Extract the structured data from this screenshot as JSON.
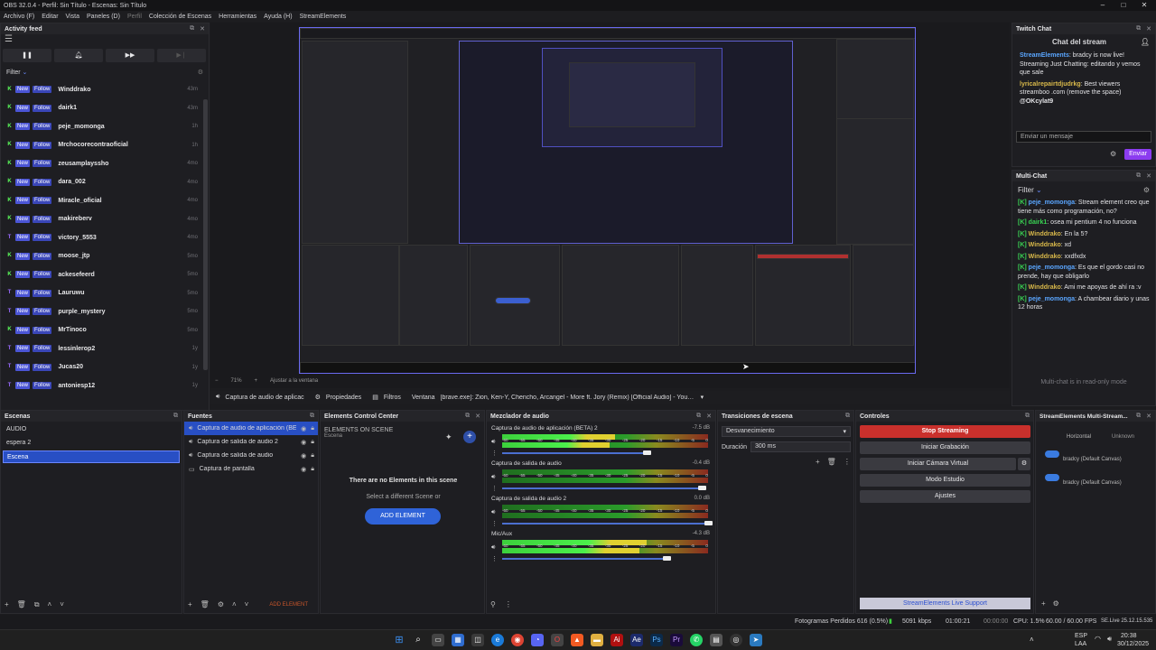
{
  "window": {
    "title": "OBS 32.0.4 - Perfil: Sin Título - Escenas: Sin Título"
  },
  "menu": [
    "Archivo (F)",
    "Editar",
    "Vista",
    "Paneles (D)",
    "Perfil",
    "Colección de Escenas",
    "Herramientas",
    "Ayuda (H)",
    "StreamElements"
  ],
  "activity_feed": {
    "title": "Activity feed",
    "filter_label": "Filter",
    "badge_new": "New",
    "badge_follow": "Follow",
    "items": [
      {
        "platform": "K",
        "name": "Winddrako",
        "time": "43m"
      },
      {
        "platform": "K",
        "name": "dairk1",
        "time": "43m"
      },
      {
        "platform": "K",
        "name": "peje_momonga",
        "time": "1h"
      },
      {
        "platform": "K",
        "name": "Mrchocorecontraoficial",
        "time": "1h"
      },
      {
        "platform": "K",
        "name": "zeusamplayssho",
        "time": "4mo"
      },
      {
        "platform": "K",
        "name": "dara_002",
        "time": "4mo"
      },
      {
        "platform": "K",
        "name": "Miracle_oficial",
        "time": "4mo"
      },
      {
        "platform": "K",
        "name": "makireberv",
        "time": "4mo"
      },
      {
        "platform": "T",
        "name": "victory_5553",
        "time": "4mo"
      },
      {
        "platform": "K",
        "name": "moose_jtp",
        "time": "5mo"
      },
      {
        "platform": "K",
        "name": "ackesefeerd",
        "time": "5mo"
      },
      {
        "platform": "T",
        "name": "Lauruwu",
        "time": "5mo"
      },
      {
        "platform": "T",
        "name": "purple_mystery",
        "time": "5mo"
      },
      {
        "platform": "K",
        "name": "MrTinoco",
        "time": "5mo"
      },
      {
        "platform": "T",
        "name": "lessinlerop2",
        "time": "1y"
      },
      {
        "platform": "T",
        "name": "Jucas20",
        "time": "1y"
      },
      {
        "platform": "T",
        "name": "antoniesp12",
        "time": "1y"
      }
    ]
  },
  "preview_bar": {
    "zoom": "71%",
    "fit": "Ajustar a la ventana"
  },
  "source_toolbar": {
    "source": "Captura de audio de aplicac",
    "properties": "Propiedades",
    "filters": "Filtros",
    "window_label": "Ventana",
    "window_value": "[brave.exe]: Zion, Ken-Y, Chencho, Arcangel - More ft. Jory (Remix) [Official Audio] - YouTube - Br"
  },
  "twitch_chat": {
    "title": "Twitch Chat",
    "header": "Chat del stream",
    "messages": [
      {
        "user": "StreamElements",
        "text": ": bradcy is now live! Streaming Just Chatting: editando y vemos que sale"
      },
      {
        "user": "lyricalrepairtdjudrkg",
        "text": ": Best viewers streamboo .com (remove the space) ",
        "mention": "@OKcylat9"
      }
    ],
    "input_placeholder": "Enviar un mensaje",
    "send": "Enviar"
  },
  "multichat": {
    "title": "Multi-Chat",
    "filter": "Filter",
    "messages": [
      {
        "user": "peje_momonga",
        "text": ": Stream element creo que tiene más como programación, no?",
        "color": "blue"
      },
      {
        "user": "dairk1",
        "text": ": osea mi pentium 4 no funciona",
        "color": "green"
      },
      {
        "user": "Winddrako",
        "text": ": En la 5?",
        "color": "gold"
      },
      {
        "user": "Winddrako",
        "text": ": xd",
        "color": "gold"
      },
      {
        "user": "Winddrako",
        "text": ": xxdfxdx",
        "color": "gold"
      },
      {
        "user": "peje_momonga",
        "text": ": Es que el gordo casi no prende, hay que obligarlo",
        "color": "blue"
      },
      {
        "user": "Winddrako",
        "text": ": Ami me apoyas de ahí ra :v",
        "color": "gold"
      },
      {
        "user": "peje_momonga",
        "text": ": A chambear diario y unas 12 horas",
        "color": "blue"
      }
    ],
    "readonly": "Multi-chat is in read-only mode"
  },
  "scenes": {
    "title": "Escenas",
    "items": [
      "AUDIO",
      "espera 2",
      "Escena"
    ],
    "selected": 2
  },
  "sources": {
    "title": "Fuentes",
    "items": [
      "Captura de audio de aplicación (BE",
      "Captura de salida de audio 2",
      "Captura de salida de audio",
      "Captura de pantalla"
    ],
    "add_element": "ADD ELEMENT"
  },
  "ecc": {
    "title": "Elements Control Center",
    "header": "ELEMENTS ON SCENE",
    "sub": "Escena",
    "empty": "There are no Elements in this scene",
    "hint": "Select a different Scene or",
    "button": "ADD ELEMENT"
  },
  "mixer": {
    "title": "Mezclador de audio",
    "ticks": [
      "-60",
      "-55",
      "-50",
      "-45",
      "-40",
      "-35",
      "-30",
      "-25",
      "-20",
      "-15",
      "-10",
      "-5",
      "0"
    ],
    "channels": [
      {
        "name": "Captura de audio de aplicación (BETA) 2",
        "db": "-7.5 dB",
        "level": 0.55,
        "volume": 0.7
      },
      {
        "name": "Captura de salida de audio",
        "db": "-0.4 dB",
        "level": 0.0,
        "volume": 0.97
      },
      {
        "name": "Captura de salida de audio 2",
        "db": "0.0 dB",
        "level": 0.0,
        "volume": 1.0
      },
      {
        "name": "Mic/Aux",
        "db": "-4.3 dB",
        "level": 0.7,
        "volume": 0.8
      }
    ]
  },
  "transitions": {
    "title": "Transiciones de escena",
    "type": "Desvanecimiento",
    "duration_label": "Duración",
    "duration": "300 ms"
  },
  "controls": {
    "title": "Controles",
    "buttons": [
      "Stop Streaming",
      "Iniciar Grabación",
      "Iniciar Cámara Virtual",
      "Modo Estudio",
      "Ajustes"
    ],
    "support": "StreamElements Live Support"
  },
  "multistream": {
    "title": "StreamElements Multi-Stream...",
    "horizontal": "Horizontal",
    "unknown": "Unknown",
    "outputs": [
      "bradcy (Default Canvas)",
      "bradcy (Default Canvas)"
    ]
  },
  "statusbar": {
    "dropped": "Fotogramas Perdidos 616 (0.5%)",
    "kbps": "5091 kbps",
    "time1": "01:00:21",
    "time2": "00:00:00",
    "cpu": "CPU: 1.5%",
    "fps": "60.00 / 60.00 FPS",
    "se": "SE.Live 25.12.15.535"
  },
  "taskbar": {
    "lang1": "ESP",
    "lang2": "LAA",
    "time": "20:38",
    "date": "30/12/2025"
  }
}
